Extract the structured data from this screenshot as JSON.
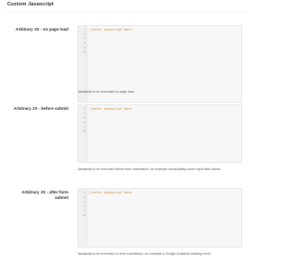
{
  "section": {
    "title": "Custom Javascript"
  },
  "fields": [
    {
      "label": "Arbitrary JS - on page load",
      "code_line_1": "//enter javascript here",
      "line_numbers": [
        "1",
        "2",
        "3",
        "4",
        "5",
        "6"
      ],
      "help": "Javascript to be executed on page load."
    },
    {
      "label": "Arbitrary JS - before submit",
      "code_line_1": "//enter javascript here",
      "line_numbers": [
        "1",
        "2",
        "3",
        "4",
        "5",
        "6"
      ],
      "help": "Javascript to be executed before form submission, for example manipulating some input field values."
    },
    {
      "label": "Arbitrary JS - after form submit",
      "code_line_1": "//enter javascript here",
      "line_numbers": [
        "1",
        "2",
        "3",
        "4",
        "5",
        "6"
      ],
      "help": "Javascript to be executed on form submission, for example a Google Analytics tracking event."
    }
  ]
}
